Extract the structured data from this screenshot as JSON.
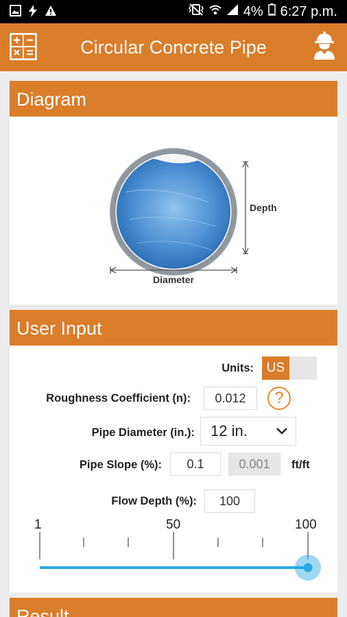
{
  "status": {
    "battery": "4%",
    "time": "6:27 p.m."
  },
  "appbar": {
    "title": "Circular Concrete Pipe"
  },
  "diagram": {
    "header": "Diagram",
    "depth_label": "Depth",
    "diameter_label": "Diameter"
  },
  "input": {
    "header": "User Input",
    "units_label": "Units:",
    "units_value": "US",
    "roughness_label": "Roughness Coefficient (n):",
    "roughness_value": "0.012",
    "help_glyph": "?",
    "diameter_label": "Pipe Diameter (in.):",
    "diameter_value": "12 in.",
    "slope_label": "Pipe Slope (%):",
    "slope_value": "0.1",
    "slope_converted": "0.001",
    "slope_unit": "ft/ft",
    "flow_label": "Flow Depth (%):",
    "flow_value": "100",
    "slider": {
      "min_label": "1",
      "mid_label": "50",
      "max_label": "100",
      "value": 100
    }
  },
  "result": {
    "header": "Result"
  },
  "colors": {
    "accent": "#d97d2b",
    "slider": "#29a8e0",
    "help": "#e8882f"
  }
}
